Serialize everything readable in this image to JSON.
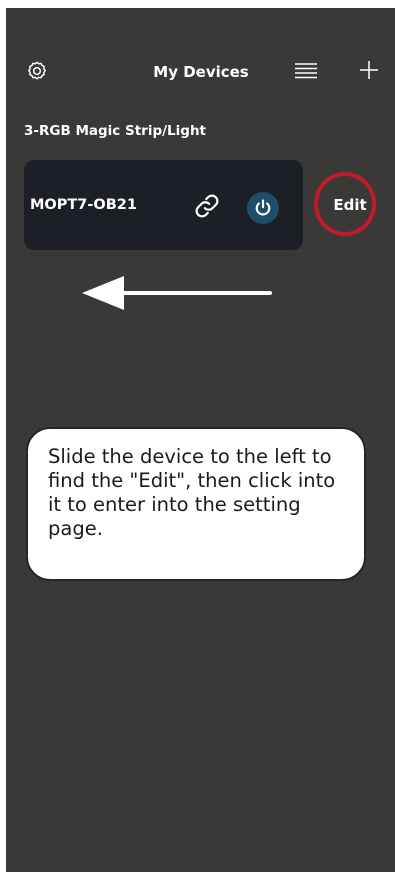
{
  "header": {
    "title": "My Devices",
    "settings_icon": "gear-icon",
    "list_icon": "list-icon",
    "add_icon": "plus-icon"
  },
  "section": {
    "label": "3-RGB Magic Strip/Light"
  },
  "device": {
    "name": "MOPT7-OB21",
    "link_icon": "link-icon",
    "power_icon": "power-icon",
    "edit_label": "Edit"
  },
  "tip": {
    "text": "Slide the device to the left to find the \"Edit\", then click into it to enter into the setting page."
  },
  "colors": {
    "background": "#3b3838",
    "card": "#1c1f26",
    "power_button": "#1d4e6e",
    "highlight_ring": "#c11b2b"
  }
}
